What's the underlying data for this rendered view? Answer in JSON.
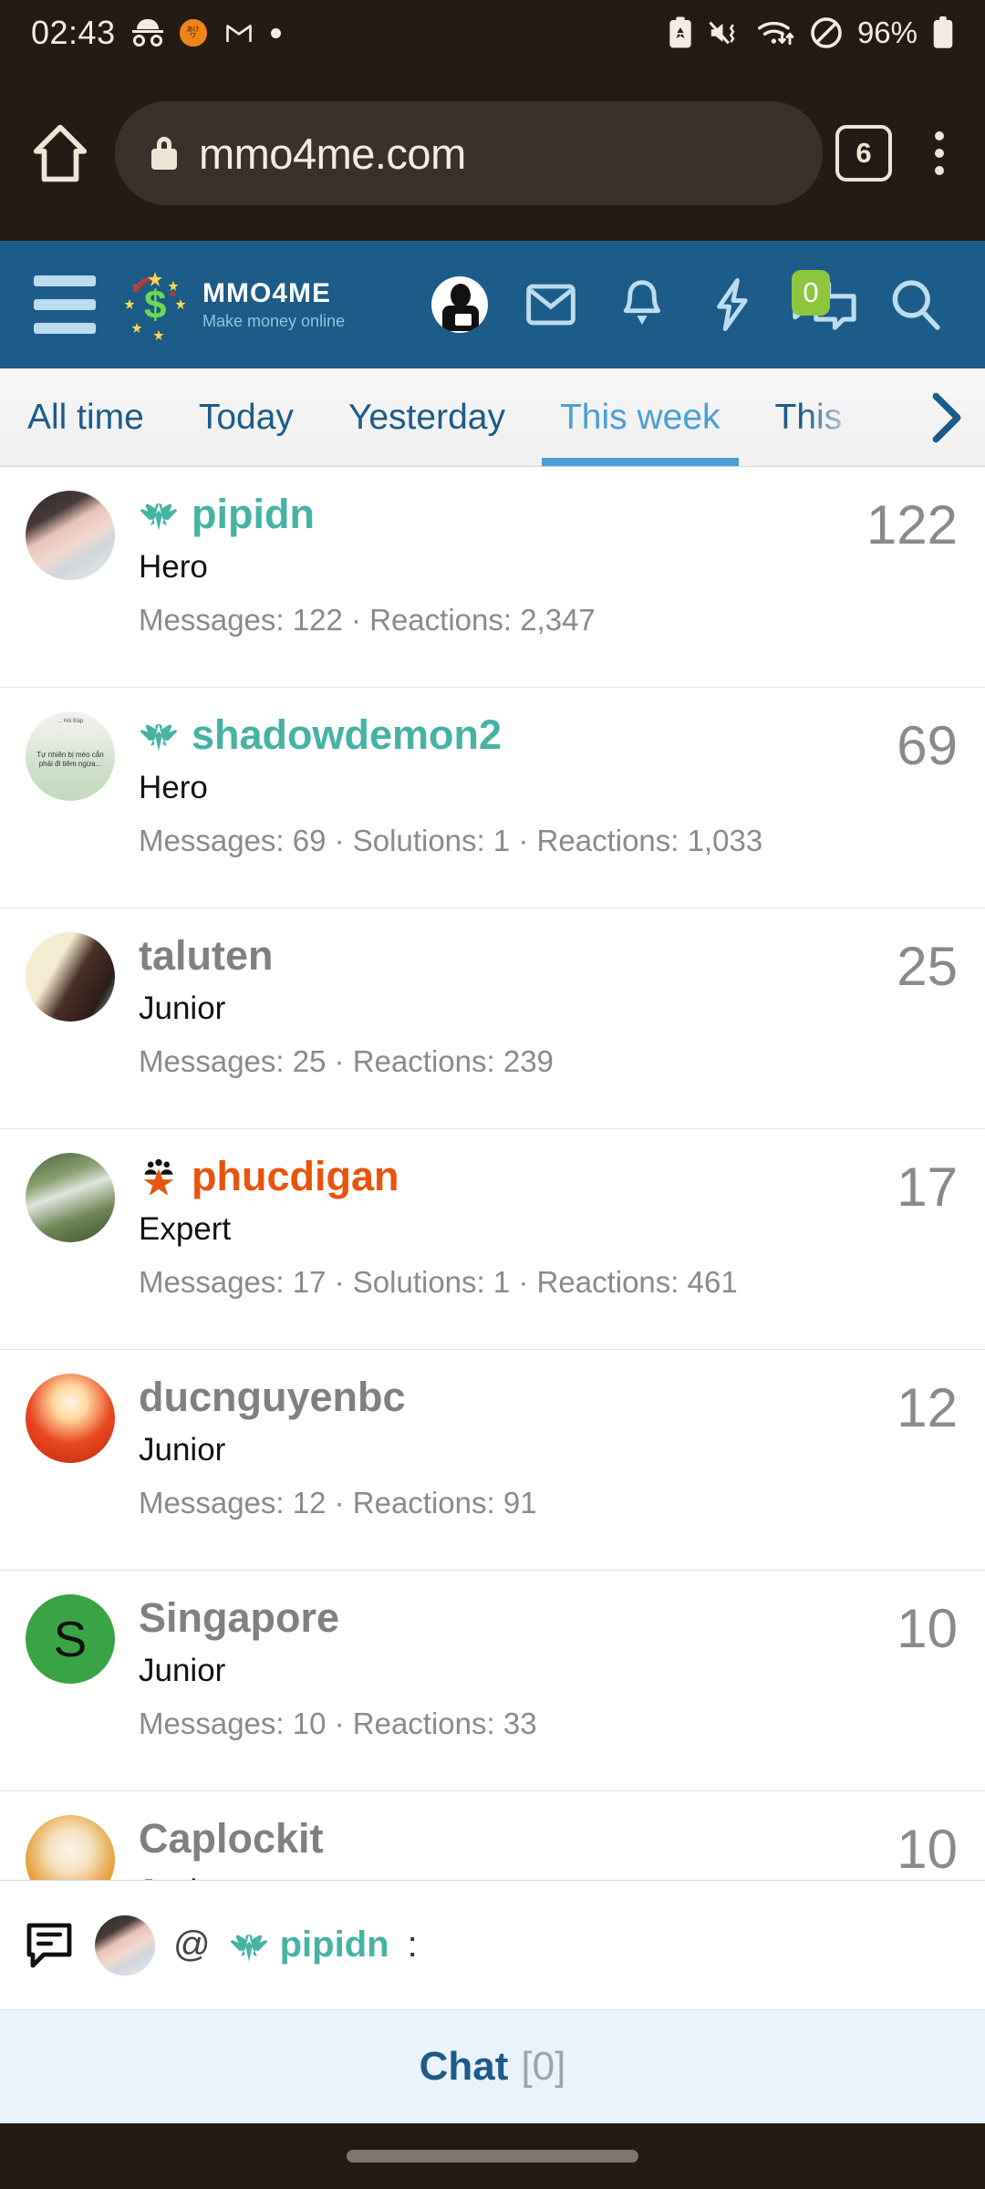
{
  "statusbar": {
    "clock": "02:43",
    "battery_pct": "96%",
    "icons": [
      "incognito-glasses-icon",
      "pumpkin-app-icon",
      "gmail-icon",
      "dot-indicator-icon",
      "recycle-battery-icon",
      "mute-vibrate-icon",
      "wifi-transfer-icon",
      "dnd-icon",
      "battery-icon"
    ]
  },
  "browser": {
    "home_icon": "home-icon",
    "lock_icon": "lock-icon",
    "url": "mmo4me.com",
    "tab_count": "6",
    "menu_icon": "kebab-menu-icon"
  },
  "sitenav": {
    "menu_icon": "hamburger-menu-icon",
    "logo_title": "MMO4ME",
    "logo_tagline": "Make money online",
    "icons": [
      {
        "name": "user-avatar-icon",
        "label": "Account"
      },
      {
        "name": "envelope-icon",
        "label": "Inbox"
      },
      {
        "name": "bell-icon",
        "label": "Alerts"
      },
      {
        "name": "lightning-bolt-icon",
        "label": "Whats new"
      },
      {
        "name": "chat-bubbles-icon",
        "label": "Chat",
        "badge": "0"
      },
      {
        "name": "search-icon",
        "label": "Search"
      }
    ],
    "badge_color": "#8cc63f",
    "bar_color": "#1d5b88"
  },
  "tabs": {
    "items": [
      {
        "label": "All time",
        "active": false
      },
      {
        "label": "Today",
        "active": false
      },
      {
        "label": "Yesterday",
        "active": false
      },
      {
        "label": "This week",
        "active": true
      },
      {
        "label": "This",
        "active": false
      }
    ],
    "next_arrow_icon": "chevron-right-icon",
    "active_color": "#4a9fd8",
    "inactive_color": "#1d5b88"
  },
  "leaderboard": {
    "rows": [
      {
        "username": "pipidn",
        "name_color": "teal",
        "badge_icon": "phoenix-wings-icon",
        "title": "Hero",
        "stats": "Messages: 122 · Reactions: 2,347",
        "count": "122",
        "avatar": "pipidn-photo"
      },
      {
        "username": "shadowdemon2",
        "name_color": "teal",
        "badge_icon": "phoenix-wings-icon",
        "title": "Hero",
        "stats": "Messages: 69 · Solutions: 1 · Reactions: 1,033",
        "count": "69",
        "avatar": "shadowdemon2-photo",
        "avatar_caption": "Tự nhiên bị mèo cắn phải đi tiêm ngừa...",
        "avatar_caption_top": "... Hỏi Đáp"
      },
      {
        "username": "taluten",
        "name_color": "grey",
        "badge_icon": "",
        "title": "Junior",
        "stats": "Messages: 25 · Reactions: 239",
        "count": "25",
        "avatar": "taluten-photo"
      },
      {
        "username": "phucdigan",
        "name_color": "orange",
        "badge_icon": "star-crowd-icon",
        "title": "Expert",
        "stats": "Messages: 17 · Solutions: 1 · Reactions: 461",
        "count": "17",
        "avatar": "phucdigan-photo"
      },
      {
        "username": "ducnguyenbc",
        "name_color": "grey",
        "badge_icon": "",
        "title": "Junior",
        "stats": "Messages: 12 · Reactions: 91",
        "count": "12",
        "avatar": "ducnguyenbc-photo"
      },
      {
        "username": "Singapore",
        "name_color": "grey",
        "badge_icon": "",
        "title": "Junior",
        "stats": "Messages: 10 · Reactions: 33",
        "count": "10",
        "avatar": "letter-S",
        "avatar_letter": "S",
        "avatar_color": "#3aa345"
      },
      {
        "username": "Caplockit",
        "name_color": "grey",
        "badge_icon": "",
        "title": "Junior",
        "stats": "",
        "count": "10",
        "avatar": "caplockit-photo"
      }
    ]
  },
  "chat": {
    "bubble_icon": "chat-message-icon",
    "avatar": "pipidn-photo",
    "at_symbol": "@",
    "mention_badge_icon": "phoenix-wings-icon",
    "mention_name": "pipidn",
    "colon": ":",
    "bar_label": "Chat",
    "bar_count": "[0]"
  }
}
